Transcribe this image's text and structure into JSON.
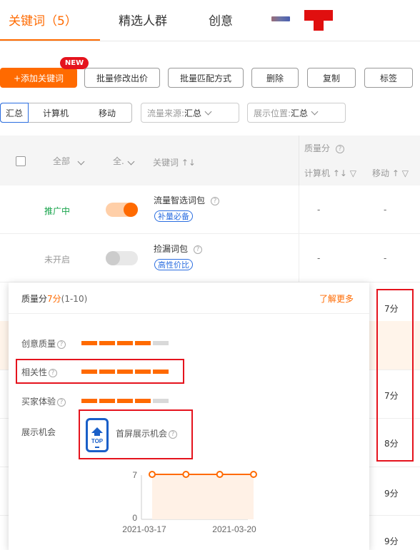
{
  "tabs": [
    {
      "label": "关键词（5）",
      "active": true
    },
    {
      "label": "精选人群",
      "active": false
    },
    {
      "label": "创意",
      "active": false
    }
  ],
  "colors": {
    "accent": "#ff6a00",
    "blue": "#2a6de0",
    "red": "#e5131d",
    "green": "#16a34a"
  },
  "toolbar": {
    "add_keyword": "+添加关键词",
    "new_badge": "NEW",
    "batch_bid": "批量修改出价",
    "batch_match": "批量匹配方式",
    "delete": "删除",
    "copy": "复制",
    "tag": "标签"
  },
  "filters": {
    "seg_all": "汇总",
    "seg_pc": "计算机",
    "seg_mobile": "移动",
    "traffic_label": "流量来源: ",
    "traffic_value": "汇总",
    "position_label": "展示位置: ",
    "position_value": "汇总"
  },
  "table_header": {
    "filter_all": "全部",
    "filter_all2": "全.",
    "keyword": "关键词",
    "quality_score": "质量分",
    "pc": "计算机",
    "mobile": "移动"
  },
  "rows": [
    {
      "status": "推广中",
      "on": true,
      "name": "流量智选词包",
      "tag": "补量必备",
      "pc": "-",
      "mobile": "-"
    },
    {
      "status": "未开启",
      "on": false,
      "name": "捡漏词包",
      "tag": "高性价比",
      "pc": "-",
      "mobile": "-"
    }
  ],
  "mobile_scores": [
    "7分",
    "7分",
    "8分",
    "9分",
    "9分"
  ],
  "popup": {
    "title_prefix": "质量分",
    "title_value": "7分",
    "title_range": "(1-10)",
    "learn_more": "了解更多",
    "metrics": [
      {
        "label": "创意质量",
        "filled": 4,
        "total": 5
      },
      {
        "label": "相关性",
        "filled": 5,
        "total": 5
      },
      {
        "label": "买家体验",
        "filled": 4,
        "total": 5
      }
    ],
    "exposure_label": "展示机会",
    "top_icon_text": "TOP",
    "exposure_value": "首屏展示机会",
    "chart": {
      "y_max_label": "7",
      "y_min_label": "0",
      "x_start": "2021-03-17",
      "x_end": "2021-03-20",
      "values": [
        7,
        7,
        7,
        7
      ]
    }
  }
}
